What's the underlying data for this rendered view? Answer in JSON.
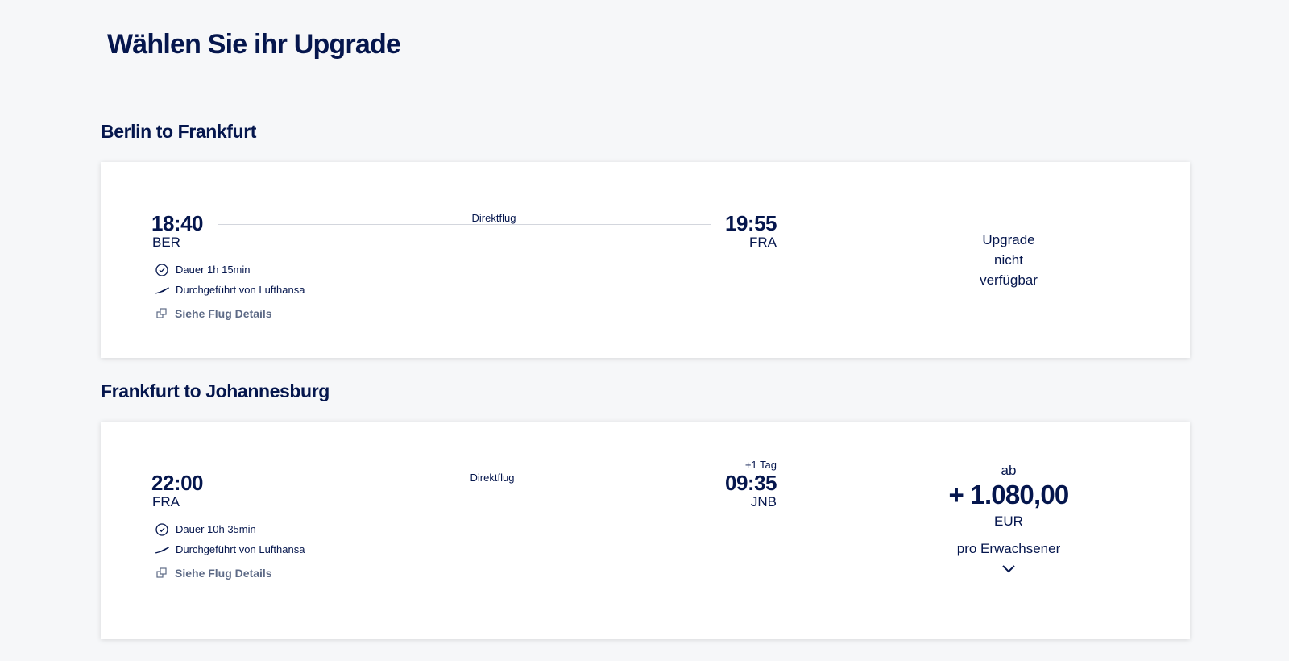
{
  "page_title": "Wählen Sie ihr Upgrade",
  "flights": [
    {
      "section_title": "Berlin to Frankfurt",
      "departure_time": "18:40",
      "departure_code": "BER",
      "arrival_time": "19:55",
      "arrival_code": "FRA",
      "flight_type": "Direktflug",
      "plus_day": "",
      "duration": "Dauer 1h 15min",
      "operator": "Durchgeführt von Lufthansa",
      "details_link": "Siehe Flug Details",
      "upgrade": {
        "unavailable_lines": [
          "Upgrade",
          "nicht",
          "verfügbar"
        ]
      }
    },
    {
      "section_title": "Frankfurt to Johannesburg",
      "departure_time": "22:00",
      "departure_code": "FRA",
      "arrival_time": "09:35",
      "arrival_code": "JNB",
      "flight_type": "Direktflug",
      "plus_day": "+1 Tag",
      "duration": "Dauer 10h 35min",
      "operator": "Durchgeführt von Lufthansa",
      "details_link": "Siehe Flug Details",
      "upgrade": {
        "from_label": "ab",
        "price": "+ 1.080,00",
        "currency": "EUR",
        "per_label": "pro Erwachsener",
        "expand_icon": "chevron-down-icon"
      }
    }
  ],
  "colors": {
    "brand_navy": "#05164d",
    "link_gray": "#5d6a86",
    "background": "#f6f7f9"
  }
}
